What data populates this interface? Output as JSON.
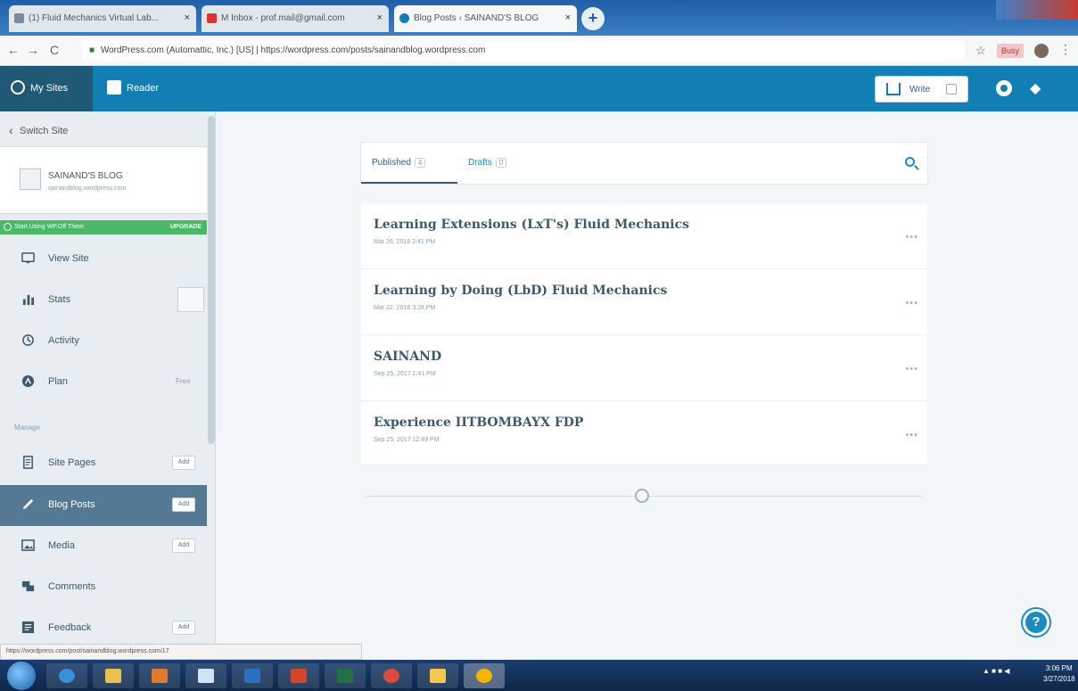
{
  "browser": {
    "tabs": [
      {
        "label": "(1) Fluid Mechanics Virtual Lab..."
      },
      {
        "label": "M Inbox - prof.mail@gmail.com"
      },
      {
        "label": "Blog Posts ‹ SAINAND'S BLOG"
      }
    ],
    "url_prefix": "WordPress.com (Automattic, Inc.) [US]",
    "url": "https://wordpress.com/posts/sainandblog.wordpress.com",
    "nav_back": "←",
    "nav_forward": "→",
    "nav_reload": "C",
    "ext_label": "Busy"
  },
  "masterbar": {
    "my_sites": "My Sites",
    "reader": "Reader",
    "write": "Write"
  },
  "sidebar": {
    "switch_site": "Switch Site",
    "site_name": "SAINAND'S BLOG",
    "site_domain": "sainandblog.wordpress.com",
    "plan_banner": "Start Using WP.Off Them",
    "plan_banner_action": "UPGRADE",
    "items": [
      {
        "label": "View Site"
      },
      {
        "label": "Stats"
      },
      {
        "label": "Activity"
      },
      {
        "label": "Plan",
        "extra": "Free"
      }
    ],
    "manage_heading": "Manage",
    "manage_items": [
      {
        "label": "Site Pages",
        "badge": "Add"
      },
      {
        "label": "Blog Posts",
        "badge": "Add"
      },
      {
        "label": "Media",
        "badge": "Add"
      },
      {
        "label": "Comments"
      },
      {
        "label": "Feedback",
        "badge": "Add"
      }
    ]
  },
  "main": {
    "filters": [
      {
        "label": "Published",
        "count": "4"
      },
      {
        "label": "Drafts",
        "count": "0"
      }
    ],
    "posts": [
      {
        "title": "Learning Extensions (LxT's) Fluid Mechanics",
        "date": "Mar 26, 2018 2:41 PM",
        "more": "•••"
      },
      {
        "title": "Learning by Doing (LbD) Fluid Mechanics",
        "date": "Mar 22, 2018 3:28 PM",
        "more": "•••"
      },
      {
        "title": "SAINAND",
        "date": "Sep 25, 2017 1:41 PM",
        "more": "•••"
      },
      {
        "title": "Experience IITBOMBAYX FDP",
        "date": "Sep 25, 2017 12:49 PM",
        "more": "•••"
      }
    ]
  },
  "help_label": "?",
  "status_url": "https://wordpress.com/post/sainandblog.wordpress.com/17",
  "taskbar": {
    "time": "3:06 PM",
    "date": "3/27/2018"
  },
  "colors": {
    "masterbar": "#117fb4",
    "sidebar_active": "#537994",
    "accent": "#1c8bc3"
  }
}
